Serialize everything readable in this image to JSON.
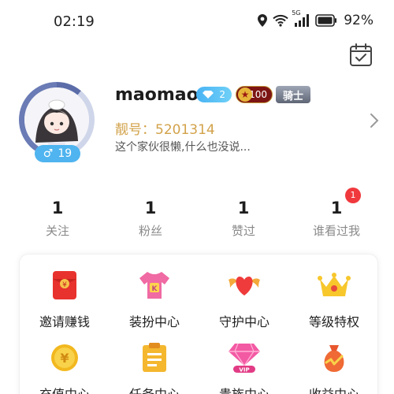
{
  "status_bar": {
    "time": "02:19",
    "network": "5G",
    "battery_percent": "92%"
  },
  "profile": {
    "username": "maomao",
    "level": "2",
    "wealth_level": "100",
    "knight_badge": "骑士",
    "pretty_id": "靓号：5201314",
    "bio": "这个家伙很懒,什么也没说...",
    "gender_symbol": "♂",
    "age": "19"
  },
  "stats": [
    {
      "value": "1",
      "label": "关注"
    },
    {
      "value": "1",
      "label": "粉丝"
    },
    {
      "value": "1",
      "label": "赞过"
    },
    {
      "value": "1",
      "label": "谁看过我",
      "badge": "1"
    }
  ],
  "features": [
    {
      "label": "邀请赚钱",
      "icon": "red-envelope-icon"
    },
    {
      "label": "装扮中心",
      "icon": "tshirt-icon"
    },
    {
      "label": "守护中心",
      "icon": "winged-heart-icon"
    },
    {
      "label": "等级特权",
      "icon": "crown-icon"
    },
    {
      "label": "充值中心",
      "icon": "gold-coin-icon"
    },
    {
      "label": "任务中心",
      "icon": "task-list-icon"
    },
    {
      "label": "贵族中心",
      "icon": "vip-diamond-icon"
    },
    {
      "label": "收益中心",
      "icon": "money-bag-icon"
    }
  ],
  "colors": {
    "accent_gold": "#d2a24a",
    "badge_blue": "#4fb4ef",
    "notification_red": "#f0393d"
  }
}
